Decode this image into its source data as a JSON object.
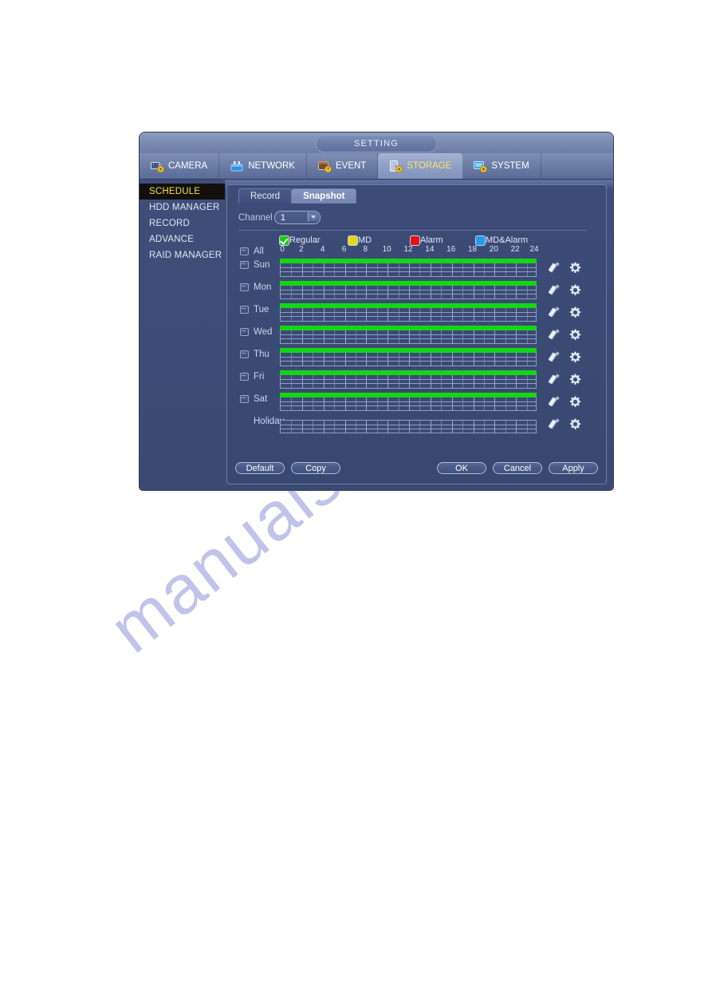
{
  "watermark": {
    "text": "manualshive.com"
  },
  "window": {
    "title": "SETTING",
    "main_tabs": [
      {
        "label": "CAMERA",
        "icon": "camera-icon",
        "active": false
      },
      {
        "label": "NETWORK",
        "icon": "network-icon",
        "active": false
      },
      {
        "label": "EVENT",
        "icon": "event-icon",
        "active": false
      },
      {
        "label": "STORAGE",
        "icon": "storage-icon",
        "active": true
      },
      {
        "label": "SYSTEM",
        "icon": "system-icon",
        "active": false
      }
    ],
    "sidebar": [
      {
        "label": "SCHEDULE",
        "active": true
      },
      {
        "label": "HDD MANAGER",
        "active": false
      },
      {
        "label": "RECORD",
        "active": false
      },
      {
        "label": "ADVANCE",
        "active": false
      },
      {
        "label": "RAID MANAGER",
        "active": false
      }
    ],
    "sub_tabs": [
      {
        "label": "Record",
        "active": false
      },
      {
        "label": "Snapshot",
        "active": true
      }
    ],
    "channel": {
      "label": "Channel",
      "value": "1",
      "options": [
        "1"
      ]
    },
    "legend": [
      {
        "label": "Regular",
        "color": "#1bc81b",
        "checked": true
      },
      {
        "label": "MD",
        "color": "#e5d718",
        "checked": false
      },
      {
        "label": "Alarm",
        "color": "#e01414",
        "checked": false
      },
      {
        "label": "MD&Alarm",
        "color": "#1f9ced",
        "checked": false
      }
    ],
    "hour_ticks": [
      0,
      2,
      4,
      6,
      8,
      10,
      12,
      14,
      16,
      18,
      20,
      22,
      24
    ],
    "all_row": {
      "label": "All",
      "has_checkbox": true
    },
    "schedule_rows": [
      {
        "label": "Sun",
        "has_checkbox": true,
        "bar": true,
        "bar_color": "#16d516",
        "period": "00:00-24:00",
        "type": "Regular"
      },
      {
        "label": "Mon",
        "has_checkbox": true,
        "bar": true,
        "bar_color": "#16d516",
        "period": "00:00-24:00",
        "type": "Regular"
      },
      {
        "label": "Tue",
        "has_checkbox": true,
        "bar": true,
        "bar_color": "#16d516",
        "period": "00:00-24:00",
        "type": "Regular"
      },
      {
        "label": "Wed",
        "has_checkbox": true,
        "bar": true,
        "bar_color": "#16d516",
        "period": "00:00-24:00",
        "type": "Regular"
      },
      {
        "label": "Thu",
        "has_checkbox": true,
        "bar": true,
        "bar_color": "#16d516",
        "period": "00:00-24:00",
        "type": "Regular"
      },
      {
        "label": "Fri",
        "has_checkbox": true,
        "bar": true,
        "bar_color": "#16d516",
        "period": "00:00-24:00",
        "type": "Regular"
      },
      {
        "label": "Sat",
        "has_checkbox": true,
        "bar": true,
        "bar_color": "#16d516",
        "period": "00:00-24:00",
        "type": "Regular"
      },
      {
        "label": "Holiday",
        "has_checkbox": false,
        "bar": false,
        "bar_color": "",
        "period": "",
        "type": ""
      }
    ],
    "row_icons": {
      "edit": "pen-icon",
      "settings": "gear-icon"
    },
    "buttons": {
      "default": "Default",
      "copy": "Copy",
      "ok": "OK",
      "cancel": "Cancel",
      "apply": "Apply"
    }
  }
}
